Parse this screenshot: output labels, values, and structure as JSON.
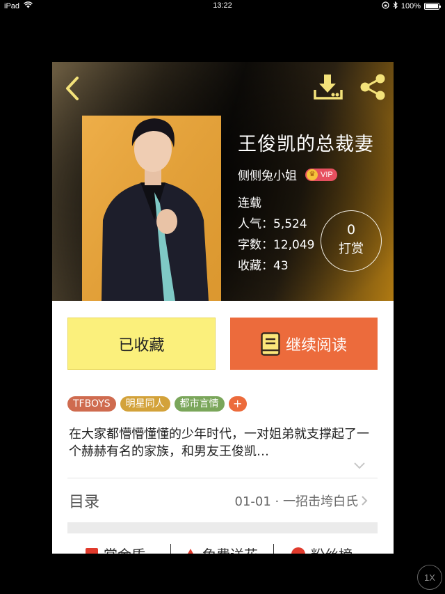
{
  "status_bar": {
    "device": "iPad",
    "time": "13:22",
    "battery": "100%",
    "icons": [
      "wifi-icon",
      "orientation-lock-icon",
      "bluetooth-icon",
      "battery-icon"
    ]
  },
  "header": {
    "back_icon": "chevron-left-icon",
    "download_icon": "download-icon",
    "share_icon": "share-icon"
  },
  "book": {
    "title": "王俊凯的总裁妻",
    "author": "侧侧兔小姐",
    "vip_label": "VIP",
    "status": "连载",
    "popularity_label": "人气：",
    "popularity": "5,524",
    "words_label": "字数：",
    "words": "12,049",
    "favorites_label": "收藏：",
    "favorites": "43"
  },
  "tip": {
    "count": "0",
    "label": "打赏"
  },
  "actions": {
    "collected_label": "已收藏",
    "continue_label": "继续阅读"
  },
  "tags": [
    {
      "label": "TFBOYS",
      "color": "#cf6b4f"
    },
    {
      "label": "明星同人",
      "color": "#d3a23a"
    },
    {
      "label": "都市言情",
      "color": "#7aa65a"
    },
    {
      "label": "+",
      "color": "#ec6b3c"
    }
  ],
  "description": "在大家都懵懵懂懂的少年时代，一对姐弟就支撑起了一个赫赫有名的家族，和男友王俊凯…",
  "catalog": {
    "label": "目录",
    "latest_chapter": "01-01 · 一招击垮白氏"
  },
  "bottom_items": [
    {
      "label": "赏金盾"
    },
    {
      "label": "免费送花"
    },
    {
      "label": "粉丝榜"
    }
  ],
  "zoom": {
    "label": "1X"
  },
  "colors": {
    "accent_orange": "#ec6b3c",
    "collect_yellow": "#fbf07c",
    "icon_yellow": "#f3e27a"
  }
}
